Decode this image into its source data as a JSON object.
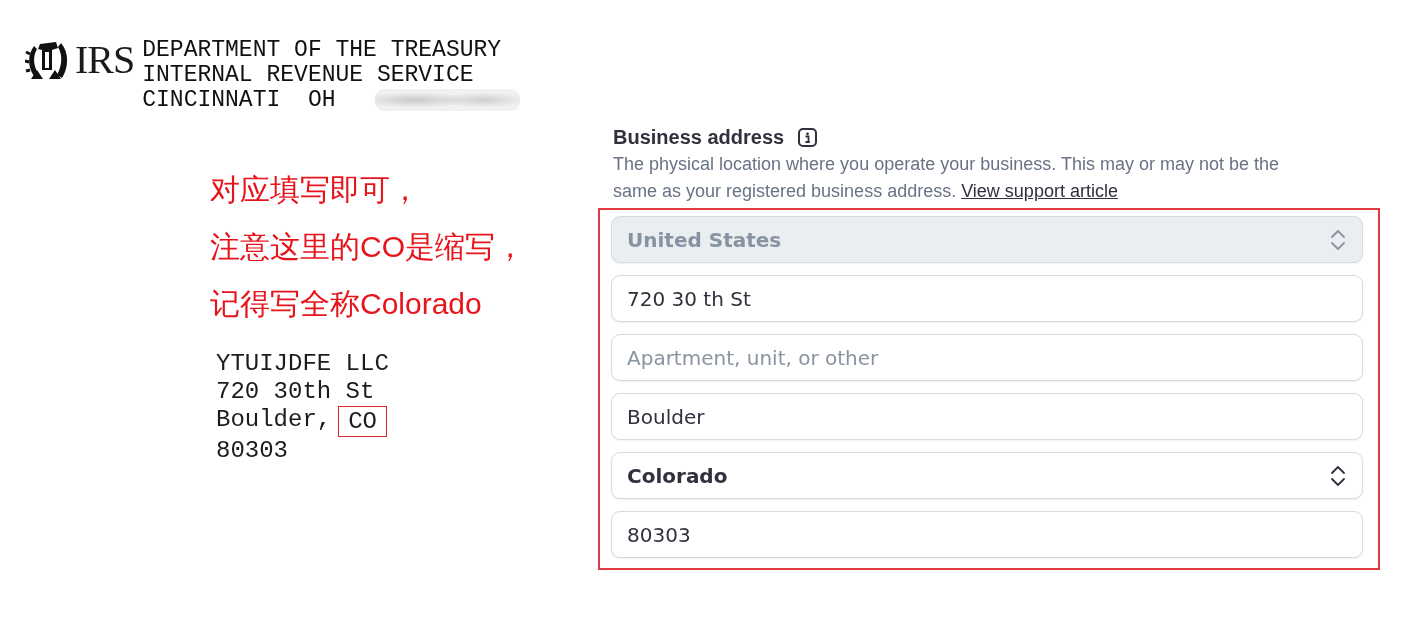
{
  "letterhead": {
    "logo_text": "IRS",
    "lines": [
      "DEPARTMENT OF THE TREASURY",
      "INTERNAL REVENUE SERVICE",
      "CINCINNATI  OH"
    ]
  },
  "note": {
    "lines": [
      "对应填写即可，",
      "注意这里的CO是缩写，",
      "记得写全称Colorado"
    ]
  },
  "mailing_address": {
    "lines": [
      [
        {
          "text": "YTUIJDFE LLC",
          "highlighted": false
        }
      ],
      [
        {
          "text": "720 30th St",
          "highlighted": false
        }
      ],
      [
        {
          "text": "Boulder,",
          "highlighted": false
        },
        {
          "text": "CO",
          "highlighted": true
        }
      ],
      [
        {
          "text": "80303",
          "highlighted": false
        }
      ]
    ]
  },
  "business_address": {
    "title": "Business address",
    "description": "The physical location where you operate your business. This may or may not be the same as your registered business address.",
    "link": "View support article",
    "outlined": true,
    "fields": [
      {
        "kind": "select",
        "value": "United States",
        "disabled": true
      },
      {
        "kind": "text",
        "value": "720 30 th St"
      },
      {
        "kind": "text",
        "placeholder": "Apartment, unit, or other"
      },
      {
        "kind": "text",
        "value": "Boulder"
      },
      {
        "kind": "select",
        "value": "Colorado",
        "disabled": false
      },
      {
        "kind": "text",
        "value": "80303"
      }
    ]
  }
}
